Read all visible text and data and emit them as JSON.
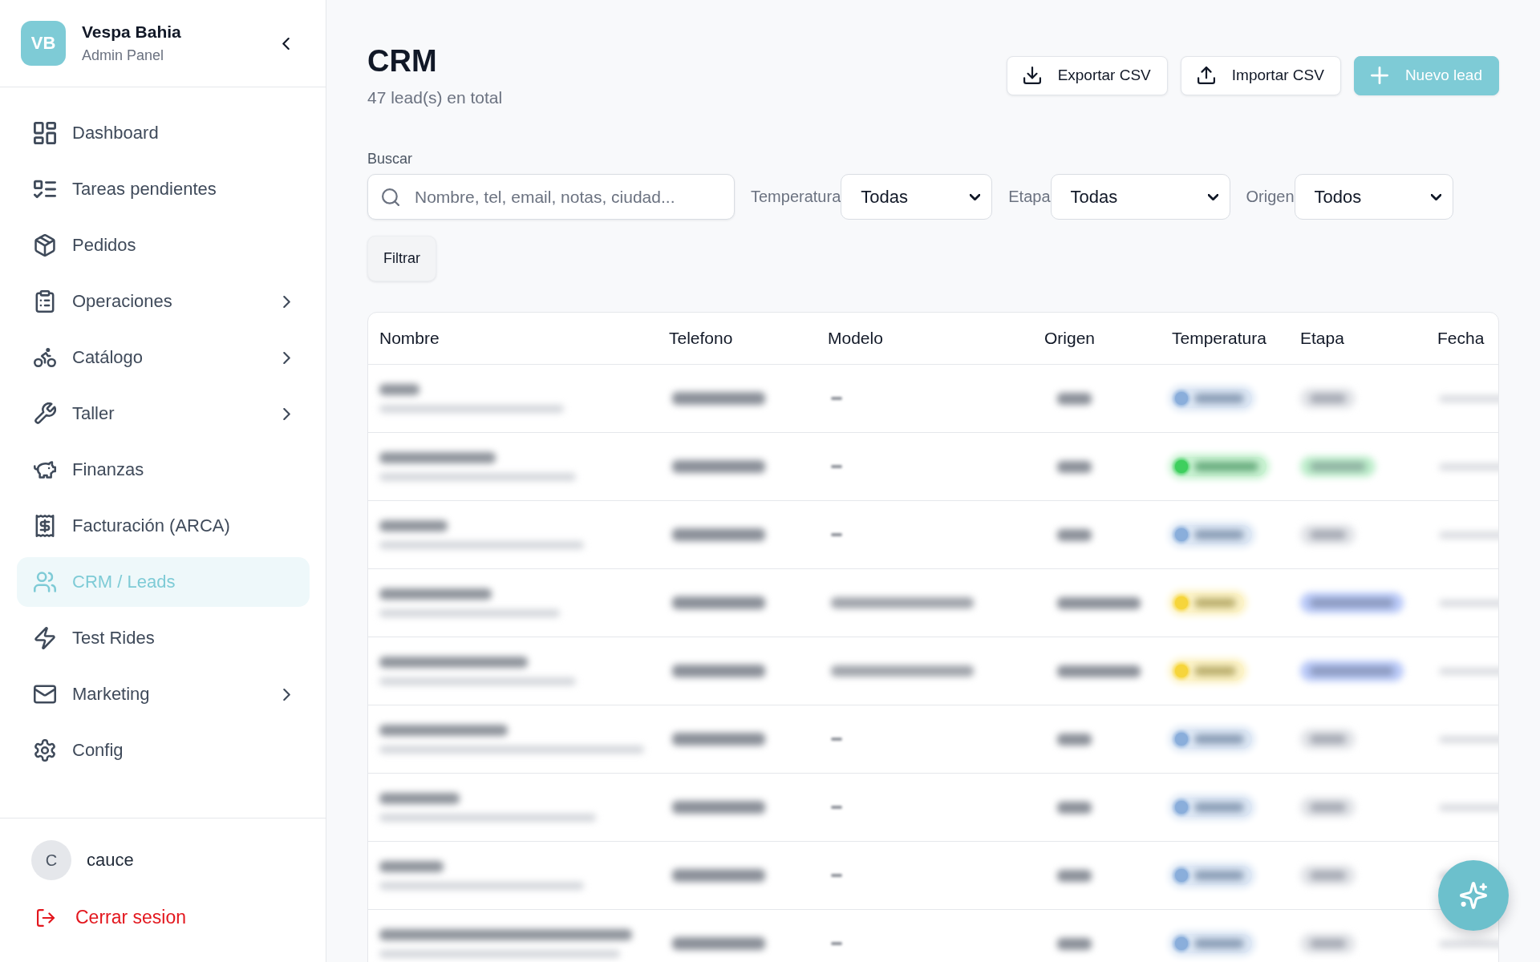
{
  "sidebar": {
    "brand": {
      "initials": "VB",
      "name": "Vespa Bahia",
      "subtitle": "Admin Panel"
    },
    "items": [
      {
        "label": "Dashboard",
        "selected": false,
        "expandable": false
      },
      {
        "label": "Tareas pendientes",
        "selected": false,
        "expandable": false
      },
      {
        "label": "Pedidos",
        "selected": false,
        "expandable": false
      },
      {
        "label": "Operaciones",
        "selected": false,
        "expandable": true
      },
      {
        "label": "Catálogo",
        "selected": false,
        "expandable": true
      },
      {
        "label": "Taller",
        "selected": false,
        "expandable": true
      },
      {
        "label": "Finanzas",
        "selected": false,
        "expandable": false
      },
      {
        "label": "Facturación (ARCA)",
        "selected": false,
        "expandable": false
      },
      {
        "label": "CRM / Leads",
        "selected": true,
        "expandable": false
      },
      {
        "label": "Test Rides",
        "selected": false,
        "expandable": false
      },
      {
        "label": "Marketing",
        "selected": false,
        "expandable": true
      },
      {
        "label": "Config",
        "selected": false,
        "expandable": false
      }
    ],
    "user": {
      "initial": "C",
      "name": "cauce"
    },
    "logout": "Cerrar sesion"
  },
  "header": {
    "title": "CRM",
    "subtitle": "47 lead(s) en total",
    "actions": [
      {
        "label": "Exportar CSV",
        "kind": "outline"
      },
      {
        "label": "Importar CSV",
        "kind": "outline"
      },
      {
        "label": "Nuevo lead",
        "kind": "primary"
      }
    ]
  },
  "filters": {
    "search": {
      "label": "Buscar",
      "placeholder": "Nombre, tel, email, notas, ciudad..."
    },
    "selects": [
      {
        "label": "Temperatura",
        "value": "Todas"
      },
      {
        "label": "Etapa",
        "value": "Todas"
      },
      {
        "label": "Origen",
        "value": "Todos"
      }
    ],
    "submit": "Filtrar"
  },
  "table": {
    "columns": [
      "Nombre",
      "Telefono",
      "Modelo",
      "Origen",
      "Temperatura",
      "Etapa",
      "Fecha"
    ],
    "rows": [
      {
        "kind": "no-model",
        "temperature": {
          "color": "#8aaedb"
        },
        "stage": {
          "color": "#e2e4e8"
        }
      },
      {
        "kind": "no-model",
        "temperature": {
          "color": "#3ecf5e"
        },
        "stage": {
          "color": "#bdeecb"
        }
      },
      {
        "kind": "no-model",
        "temperature": {
          "color": "#8aaedb"
        },
        "stage": {
          "color": "#e2e4e8"
        }
      },
      {
        "kind": "with-model",
        "temperature": {
          "color": "#f6d53b"
        },
        "stage": {
          "color": "#b9c9f8"
        }
      },
      {
        "kind": "with-model",
        "temperature": {
          "color": "#f6d53b"
        },
        "stage": {
          "color": "#b9c9f8"
        }
      },
      {
        "kind": "no-model",
        "temperature": {
          "color": "#8aaedb"
        },
        "stage": {
          "color": "#e2e4e8"
        }
      },
      {
        "kind": "no-model",
        "temperature": {
          "color": "#8aaedb"
        },
        "stage": {
          "color": "#e2e4e8"
        }
      },
      {
        "kind": "no-model",
        "temperature": {
          "color": "#8aaedb"
        },
        "stage": {
          "color": "#e2e4e8"
        }
      },
      {
        "kind": "no-model",
        "temperature": {
          "color": "#8aaedb"
        },
        "stage": {
          "color": "#e2e4e8"
        }
      }
    ]
  }
}
